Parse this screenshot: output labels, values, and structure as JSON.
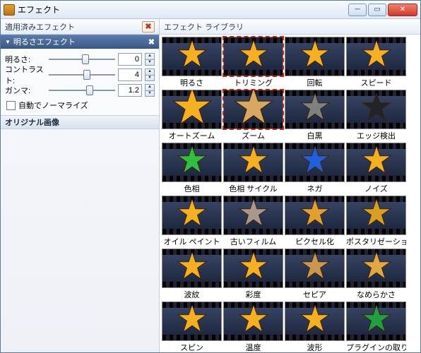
{
  "window": {
    "title": "エフェクト"
  },
  "left": {
    "applied_label": "適用済みエフェクト",
    "effect_header": "明るさエフェクト",
    "props": [
      {
        "label": "明るさ:",
        "value": "0",
        "thumb_pct": 50
      },
      {
        "label": "コントラスト:",
        "value": "4",
        "thumb_pct": 52
      },
      {
        "label": "ガンマ:",
        "value": "1.2",
        "thumb_pct": 56
      }
    ],
    "auto_normalize": "自動でノーマライズ",
    "original_header": "オリジナル画像"
  },
  "library": {
    "header": "エフェクト ライブラリ",
    "effects": [
      {
        "name": "明るさ",
        "star_fill": "#f4b020",
        "selected": false,
        "big": false
      },
      {
        "name": "トリミング",
        "star_fill": "#f4b020",
        "selected": true,
        "big": false
      },
      {
        "name": "回転",
        "star_fill": "#f4b020",
        "selected": false,
        "big": false
      },
      {
        "name": "スピード",
        "star_fill": "#f4b020",
        "selected": false,
        "big": false
      },
      {
        "name": "オートズーム",
        "star_fill": "#f4b020",
        "selected": false,
        "big": true
      },
      {
        "name": "ズーム",
        "star_fill": "#d8a860",
        "selected": true,
        "big": true
      },
      {
        "name": "白黒",
        "star_fill": "#808080",
        "selected": false,
        "big": false
      },
      {
        "name": "エッジ検出",
        "star_fill": "#202428",
        "selected": false,
        "big": false
      },
      {
        "name": "色相",
        "star_fill": "#30c040",
        "selected": false,
        "big": false
      },
      {
        "name": "色相 サイクル",
        "star_fill": "#f4b020",
        "selected": false,
        "big": false
      },
      {
        "name": "ネガ",
        "star_fill": "#2060e0",
        "selected": false,
        "big": false
      },
      {
        "name": "ノイズ",
        "star_fill": "#f4b020",
        "selected": false,
        "big": false
      },
      {
        "name": "オイル ペイント",
        "star_fill": "#f4b020",
        "selected": false,
        "big": false
      },
      {
        "name": "古いフィルム",
        "star_fill": "#a8988a",
        "selected": false,
        "big": false
      },
      {
        "name": "ピクセル化",
        "star_fill": "#e0a030",
        "selected": false,
        "big": false
      },
      {
        "name": "ポスタリゼーション",
        "star_fill": "#d8a020",
        "selected": false,
        "big": false
      },
      {
        "name": "波紋",
        "star_fill": "#f4b020",
        "selected": false,
        "big": false
      },
      {
        "name": "彩度",
        "star_fill": "#f4b020",
        "selected": false,
        "big": false
      },
      {
        "name": "セピア",
        "star_fill": "#c89850",
        "selected": false,
        "big": false
      },
      {
        "name": "なめらかさ",
        "star_fill": "#e0a840",
        "selected": false,
        "big": false
      },
      {
        "name": "スピン",
        "star_fill": "#f4b020",
        "selected": false,
        "big": false
      },
      {
        "name": "温度",
        "star_fill": "#f4b020",
        "selected": false,
        "big": false
      },
      {
        "name": "波形",
        "star_fill": "#f4b020",
        "selected": false,
        "big": false
      },
      {
        "name": "プラグインの取り込み削除",
        "star_fill": "#20a040",
        "selected": false,
        "big": false
      }
    ]
  }
}
